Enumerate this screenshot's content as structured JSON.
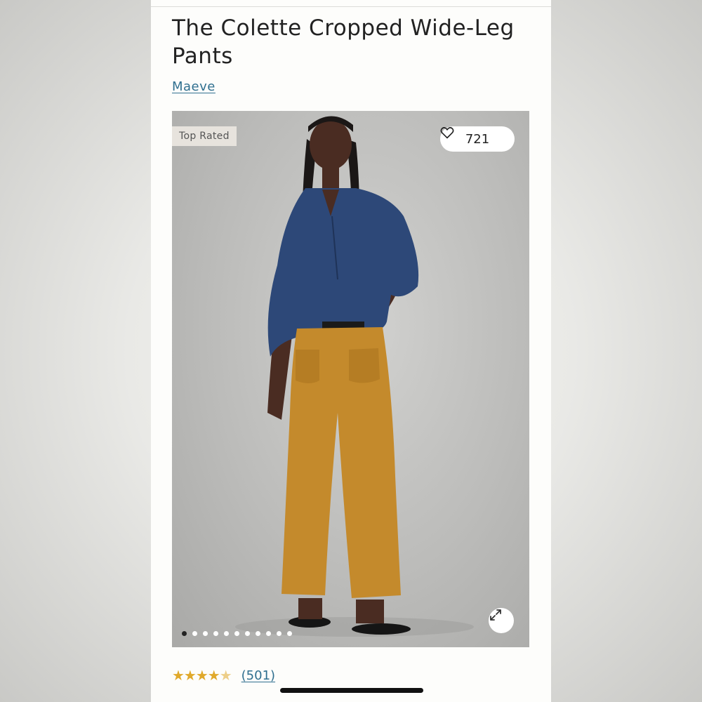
{
  "product": {
    "title": "The Colette Cropped Wide-Leg Pants",
    "brand": "Maeve",
    "badge": "Top Rated",
    "likes": "721",
    "rating": 4.5,
    "stars": "★★★★",
    "half_star": "★",
    "review_count": "(501)"
  },
  "carousel": {
    "total_images": 11,
    "active_index": 0
  },
  "icons": {
    "like": "heart-icon",
    "expand": "expand-icon"
  },
  "colors": {
    "link": "#2f6f8f",
    "star": "#e0a92b",
    "badge_bg": "#e7e3dd",
    "pants": "#c48a2c",
    "top": "#2d4878"
  }
}
